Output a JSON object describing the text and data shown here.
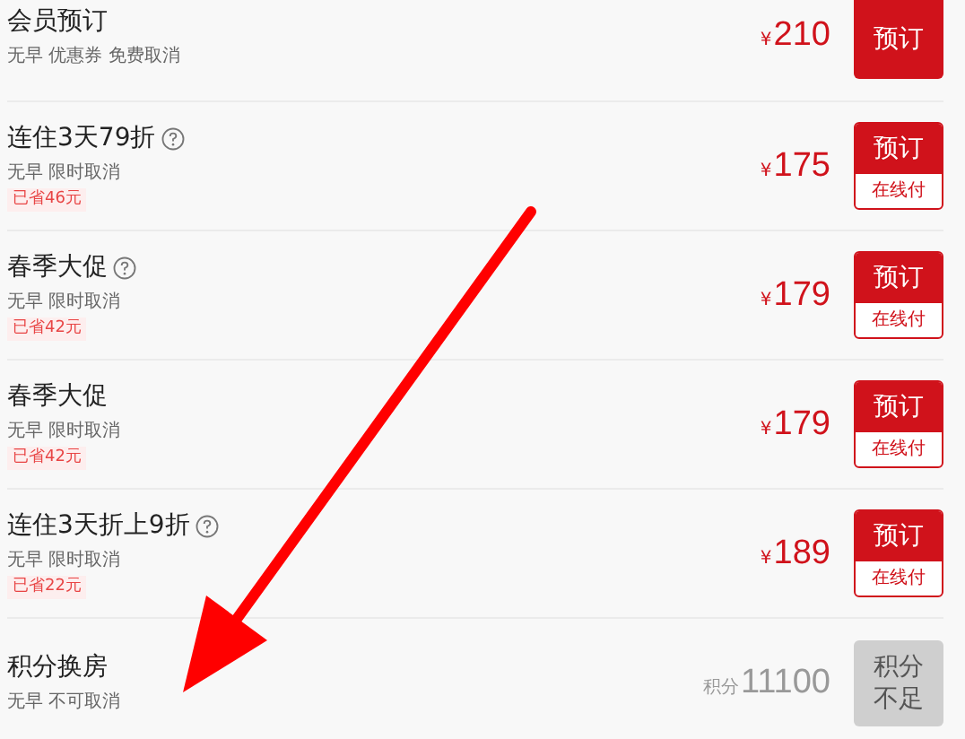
{
  "rooms": [
    {
      "name": "会员预订",
      "help": false,
      "tags": "无早 优惠券 免费取消",
      "currency": "¥",
      "price": "210",
      "button": {
        "label": "预订"
      },
      "disabled": false
    },
    {
      "name": "连住3天79折",
      "help": true,
      "tags": "无早 限时取消",
      "saved": "已省46元",
      "currency": "¥",
      "price": "175",
      "button": {
        "label": "预订",
        "sub": "在线付"
      },
      "disabled": false
    },
    {
      "name": "春季大促",
      "help": true,
      "tags": "无早 限时取消",
      "saved": "已省42元",
      "currency": "¥",
      "price": "179",
      "button": {
        "label": "预订",
        "sub": "在线付"
      },
      "disabled": false
    },
    {
      "name": "春季大促",
      "help": false,
      "tags": "无早 限时取消",
      "saved": "已省42元",
      "currency": "¥",
      "price": "179",
      "button": {
        "label": "预订",
        "sub": "在线付"
      },
      "disabled": false
    },
    {
      "name": "连住3天折上9折",
      "help": true,
      "tags": "无早 限时取消",
      "saved": "已省22元",
      "currency": "¥",
      "price": "189",
      "button": {
        "label": "预订",
        "sub": "在线付"
      },
      "disabled": false
    },
    {
      "name": "积分换房",
      "help": false,
      "tags": "无早 不可取消",
      "currency": "积分",
      "price": "11100",
      "button": {
        "label": "积分不足"
      },
      "disabled": true
    }
  ]
}
